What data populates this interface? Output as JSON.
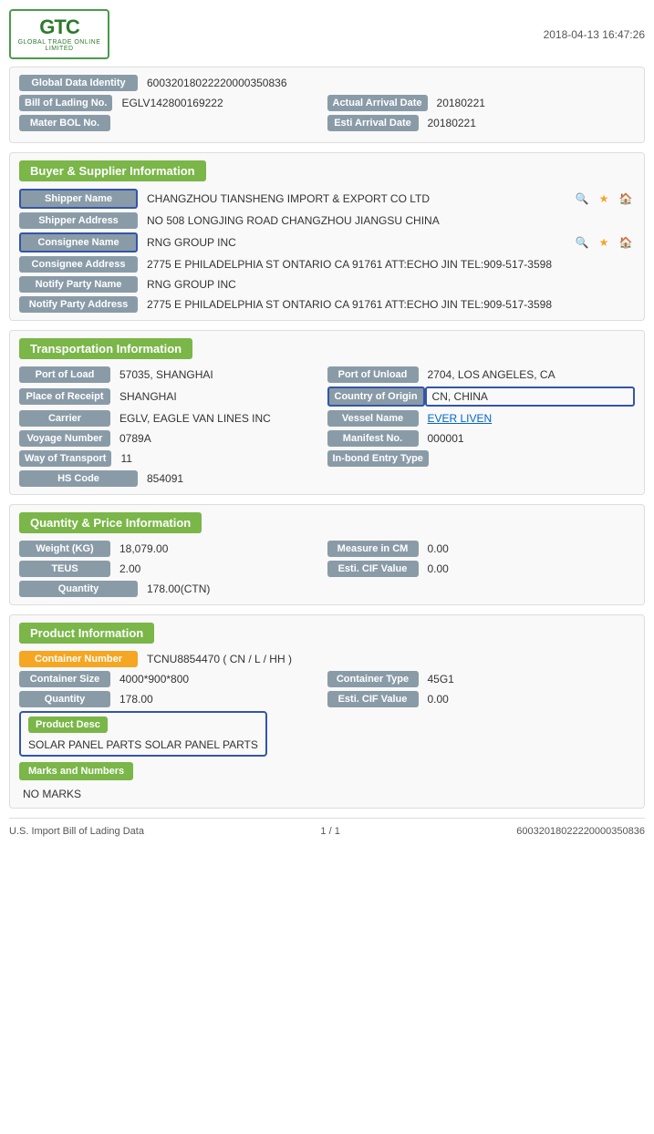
{
  "header": {
    "logo_letters": "GTC",
    "logo_sub": "GLOBAL TRADE ONLINE LIMITED",
    "timestamp": "2018-04-13 16:47:26"
  },
  "top_info": {
    "global_data_identity_label": "Global Data Identity",
    "global_data_identity_value": "60032018022220000350836",
    "bill_of_lading_label": "Bill of Lading No.",
    "bill_of_lading_value": "EGLV142800169222",
    "actual_arrival_label": "Actual Arrival Date",
    "actual_arrival_value": "20180221",
    "mater_bol_label": "Mater BOL No.",
    "mater_bol_value": "",
    "esti_arrival_label": "Esti Arrival Date",
    "esti_arrival_value": "20180221"
  },
  "buyer_supplier": {
    "section_title": "Buyer & Supplier Information",
    "shipper_name_label": "Shipper Name",
    "shipper_name_value": "CHANGZHOU TIANSHENG IMPORT & EXPORT CO LTD",
    "shipper_address_label": "Shipper Address",
    "shipper_address_value": "NO 508 LONGJING ROAD CHANGZHOU JIANGSU CHINA",
    "consignee_name_label": "Consignee Name",
    "consignee_name_value": "RNG GROUP INC",
    "consignee_address_label": "Consignee Address",
    "consignee_address_value": "2775 E PHILADELPHIA ST ONTARIO CA 91761 ATT:ECHO JIN TEL:909-517-3598",
    "notify_party_name_label": "Notify Party Name",
    "notify_party_name_value": "RNG GROUP INC",
    "notify_party_address_label": "Notify Party Address",
    "notify_party_address_value": "2775 E PHILADELPHIA ST ONTARIO CA 91761 ATT:ECHO JIN TEL:909-517-3598"
  },
  "transportation": {
    "section_title": "Transportation Information",
    "port_of_load_label": "Port of Load",
    "port_of_load_value": "57035, SHANGHAI",
    "port_of_unload_label": "Port of Unload",
    "port_of_unload_value": "2704, LOS ANGELES, CA",
    "place_of_receipt_label": "Place of Receipt",
    "place_of_receipt_value": "SHANGHAI",
    "country_of_origin_label": "Country of Origin",
    "country_of_origin_value": "CN, CHINA",
    "carrier_label": "Carrier",
    "carrier_value": "EGLV, EAGLE VAN LINES INC",
    "vessel_name_label": "Vessel Name",
    "vessel_name_value": "EVER LIVEN",
    "voyage_number_label": "Voyage Number",
    "voyage_number_value": "0789A",
    "manifest_no_label": "Manifest No.",
    "manifest_no_value": "000001",
    "way_of_transport_label": "Way of Transport",
    "way_of_transport_value": "11",
    "in_bond_entry_label": "In-bond Entry Type",
    "in_bond_entry_value": "",
    "hs_code_label": "HS Code",
    "hs_code_value": "854091"
  },
  "quantity_price": {
    "section_title": "Quantity & Price Information",
    "weight_label": "Weight (KG)",
    "weight_value": "18,079.00",
    "measure_cm_label": "Measure in CM",
    "measure_cm_value": "0.00",
    "teus_label": "TEUS",
    "teus_value": "2.00",
    "esti_cif_label": "Esti. CIF Value",
    "esti_cif_value": "0.00",
    "quantity_label": "Quantity",
    "quantity_value": "178.00(CTN)"
  },
  "product_information": {
    "section_title": "Product Information",
    "container_number_label": "Container Number",
    "container_number_value": "TCNU8854470 ( CN / L / HH )",
    "container_size_label": "Container Size",
    "container_size_value": "4000*900*800",
    "container_type_label": "Container Type",
    "container_type_value": "45G1",
    "quantity_label": "Quantity",
    "quantity_value": "178.00",
    "esti_cif_label": "Esti. CIF Value",
    "esti_cif_value": "0.00",
    "product_desc_label": "Product Desc",
    "product_desc_value": "SOLAR PANEL PARTS SOLAR PANEL PARTS",
    "marks_numbers_label": "Marks and Numbers",
    "marks_numbers_value": "NO MARKS"
  },
  "footer": {
    "left_text": "U.S. Import Bill of Lading Data",
    "page_info": "1 / 1",
    "right_text": "60032018022220000350836"
  }
}
